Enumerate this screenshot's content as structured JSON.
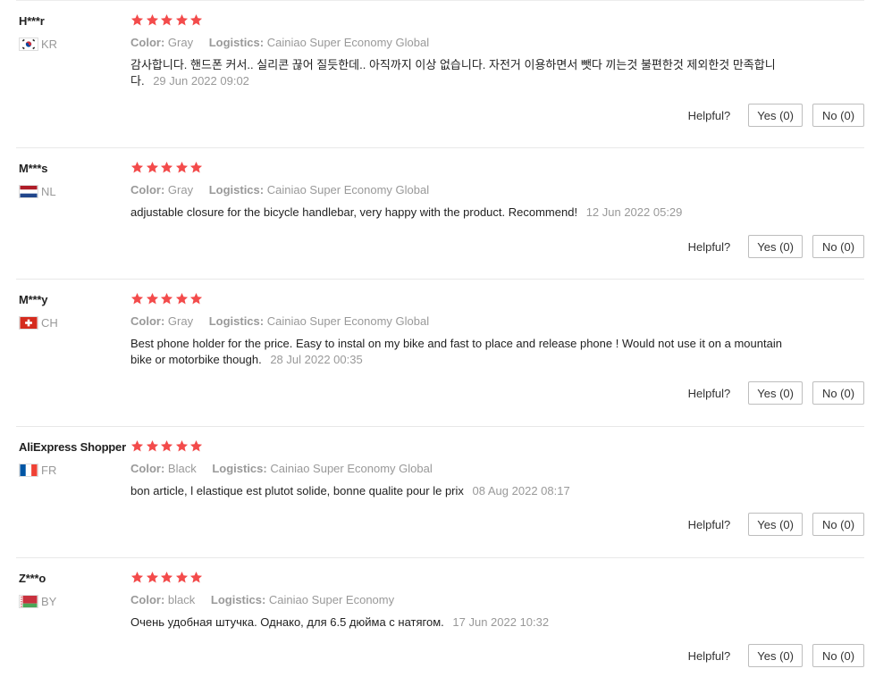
{
  "labels": {
    "color": "Color:",
    "logistics": "Logistics:",
    "helpful": "Helpful?",
    "yes": "Yes (0)",
    "no": "No (0)"
  },
  "colors": {
    "star": "#f34b4b",
    "muted_text": "#999999"
  },
  "reviews": [
    {
      "user": "H***r",
      "country": "KR",
      "rating": 5,
      "color": "Gray",
      "logistics": "Cainiao Super Economy Global",
      "comment": "감사합니다. 핸드폰 커서.. 실리콘 끊어 질듯한데.. 아직까지 이상 없습니다. 자전거 이용하면서 뺏다 끼는것 불편한것 제외한것 만족합니다.",
      "date": "29 Jun 2022 09:02",
      "helpful_yes": "Yes (0)",
      "helpful_no": "No (0)"
    },
    {
      "user": "M***s",
      "country": "NL",
      "rating": 5,
      "color": "Gray",
      "logistics": "Cainiao Super Economy Global",
      "comment": "adjustable closure for the bicycle handlebar, very happy with the product. Recommend!",
      "date": "12 Jun 2022 05:29",
      "helpful_yes": "Yes (0)",
      "helpful_no": "No (0)"
    },
    {
      "user": "M***y",
      "country": "CH",
      "rating": 5,
      "color": "Gray",
      "logistics": "Cainiao Super Economy Global",
      "comment": "Best phone holder for the price. Easy to instal on my bike and fast to place and release phone ! Would not use it on a mountain bike or motorbike though.",
      "date": "28 Jul 2022 00:35",
      "helpful_yes": "Yes (0)",
      "helpful_no": "No (0)"
    },
    {
      "user": "AliExpress Shopper",
      "country": "FR",
      "rating": 5,
      "color": "Black",
      "logistics": "Cainiao Super Economy Global",
      "comment": "bon article, l elastique est plutot solide, bonne qualite pour le prix",
      "date": "08 Aug 2022 08:17",
      "helpful_yes": "Yes (0)",
      "helpful_no": "No (0)"
    },
    {
      "user": "Z***o",
      "country": "BY",
      "rating": 5,
      "color": "black",
      "logistics": "Cainiao Super Economy",
      "comment": "Очень удобная штучка. Однако, для 6.5 дюйма с натягом.",
      "date": "17 Jun 2022 10:32",
      "helpful_yes": "Yes (0)",
      "helpful_no": "No (0)"
    }
  ]
}
